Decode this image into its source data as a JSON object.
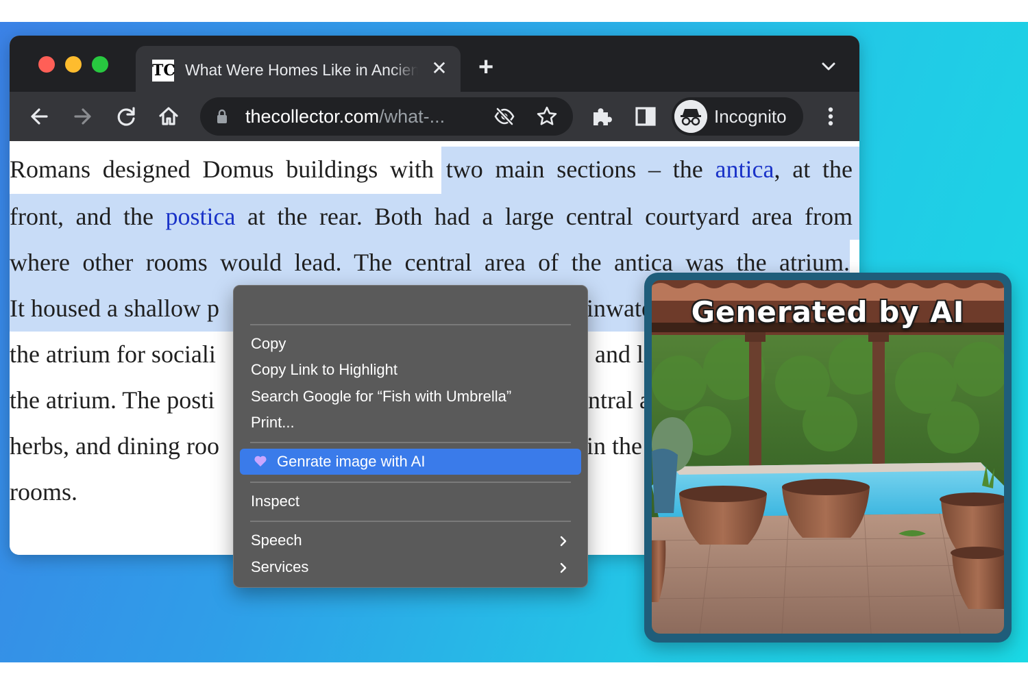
{
  "window": {
    "traffic_lights": [
      "#ff5f57",
      "#febc2e",
      "#28c840"
    ]
  },
  "tab": {
    "favicon_text": "TC",
    "title": "What Were Homes Like in Ancient Rome",
    "close_icon": "close-icon"
  },
  "toolbar": {
    "url_host": "thecollector.com",
    "url_rest": "/what-...",
    "incognito_label": "Incognito"
  },
  "article": {
    "lines": [
      {
        "parts": [
          "Romans designed Domus buildings with two main sections – the ",
          "antica",
          ", at the"
        ]
      },
      {
        "parts": [
          "front, and the ",
          "postica",
          " at the rear. Both had a large central courtyard area from"
        ]
      },
      {
        "text": "where other rooms would lead. The central area of the antica was the atrium."
      },
      {
        "left": "It housed a shallow p",
        "right": "inwate"
      },
      {
        "left": "the atrium for sociali",
        "right": "and l"
      },
      {
        "left": "the atrium. The posti",
        "right": "ntral a"
      },
      {
        "left": "herbs, and dining roo",
        "right": "in the"
      },
      {
        "text": "rooms."
      }
    ]
  },
  "context_menu": {
    "items": {
      "copy": "Copy",
      "copy_link": "Copy Link to Highlight",
      "search": "Search Google for “Fish with Umbrella”",
      "print": "Print...",
      "generate": "Genrate image with AI",
      "inspect": "Inspect",
      "speech": "Speech",
      "services": "Services"
    },
    "highlight_color": "#3a7bea"
  },
  "ai_panel": {
    "title": "Generated by AI"
  },
  "colors": {
    "link": "#1a33c8",
    "selection": "#c8dcf7"
  }
}
